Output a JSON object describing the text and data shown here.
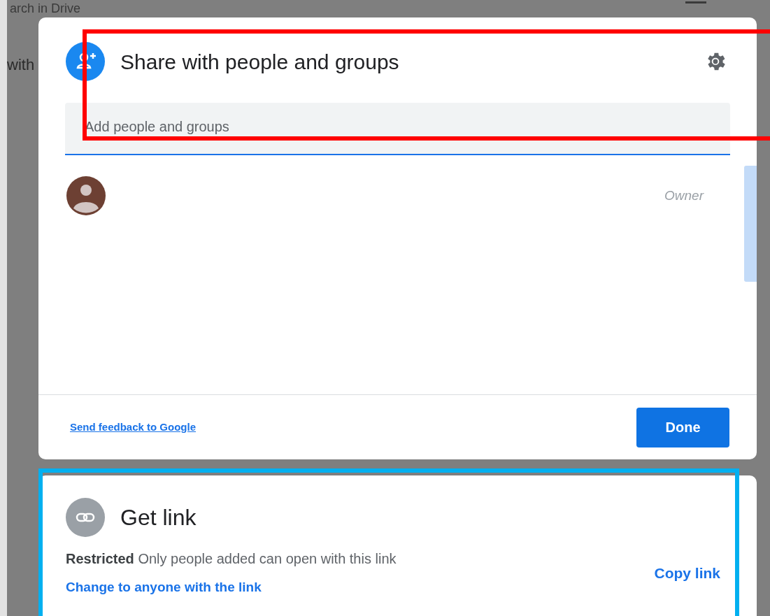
{
  "background": {
    "search_text": "arch in Drive",
    "column_text": "with"
  },
  "share_dialog": {
    "title": "Share with people and groups",
    "field": {
      "placeholder": "Add people and groups"
    },
    "people": [
      {
        "role": "Owner"
      }
    ],
    "feedback_link": "Send feedback to Google",
    "done_button": "Done"
  },
  "link_card": {
    "title": "Get link",
    "access_label": "Restricted",
    "access_description": "Only people added can open with this link",
    "change_link": "Change to anyone with the link",
    "copy_link": "Copy link"
  },
  "annotations": [
    {
      "color": "#ff0000"
    },
    {
      "color": "#00b0f0"
    }
  ]
}
